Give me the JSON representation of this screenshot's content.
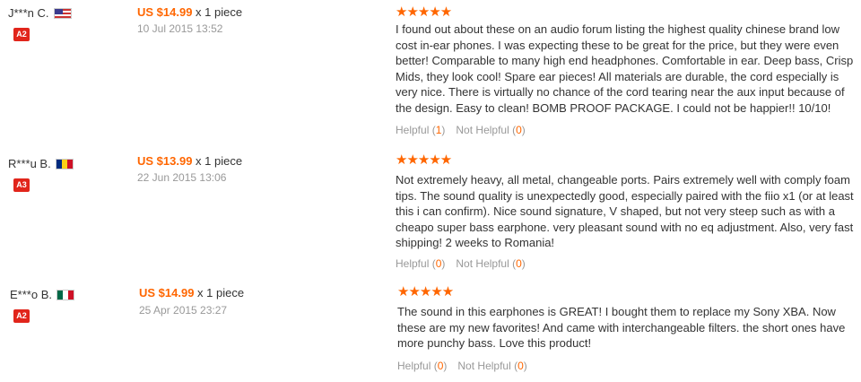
{
  "reviews": [
    {
      "user": "J***n C.",
      "flag_icon": "us-flag-icon",
      "badge": "A2",
      "price": "US $14.99",
      "qty": " x 1 piece",
      "date": "10 Jul 2015 13:52",
      "rating": 5,
      "stars": "★★★★★",
      "text": "I found out about these on an audio forum listing the highest quality chinese brand low cost in-ear phones. I was expecting these to be great for the price, but they were even better! Comparable to many high end headphones. Comfortable in ear. Deep bass, Crisp Mids, they look cool! Spare ear pieces! All materials are durable, the cord especially is very nice. There is virtually no chance of the cord tearing near the aux input because of the design. Easy to clean! BOMB PROOF PACKAGE. I could not be happier!! 10/10!",
      "helpful_label": "Helpful",
      "helpful_count": "1",
      "not_helpful_label": "Not Helpful",
      "not_helpful_count": "0"
    },
    {
      "user": "R***u B.",
      "flag_icon": "romania-flag-icon",
      "badge": "A3",
      "price": "US $13.99",
      "qty": " x 1 piece",
      "date": "22 Jun 2015 13:06",
      "rating": 5,
      "stars": "★★★★★",
      "text": "Not extremely heavy, all metal, changeable ports. Pairs extremely well with comply foam tips. The sound quality is unexpectedly good, especially paired with the fiio x1 (or at least this i can confirm). Nice sound signature, V shaped, but not very steep such as with a cheapo super bass earphone. very pleasant sound with no eq adjustment. Also, very fast shipping! 2 weeks to Romania!",
      "helpful_label": "Helpful",
      "helpful_count": "0",
      "not_helpful_label": "Not Helpful",
      "not_helpful_count": "0"
    },
    {
      "user": "E***o B.",
      "flag_icon": "mexico-flag-icon",
      "badge": "A2",
      "price": "US $14.99",
      "qty": " x 1 piece",
      "date": "25 Apr 2015 23:27",
      "rating": 5,
      "stars": "★★★★★",
      "text": "The sound in this earphones is GREAT! I bought them to replace my Sony XBA. Now these are my new favorites! And came with interchangeable filters. the short ones have more punchy bass. Love this product!",
      "helpful_label": "Helpful",
      "helpful_count": "0",
      "not_helpful_label": "Not Helpful",
      "not_helpful_count": "0"
    }
  ],
  "colors": {
    "accent": "#ff6600",
    "badge": "#e1251b",
    "muted": "#999999"
  }
}
